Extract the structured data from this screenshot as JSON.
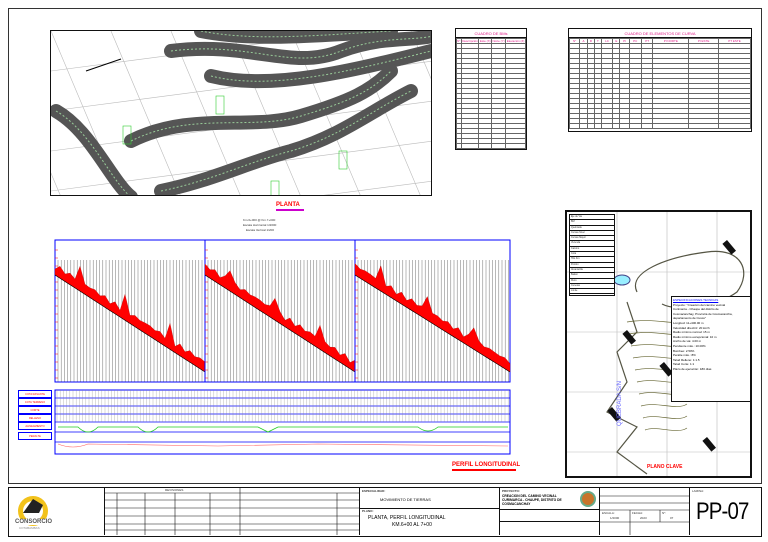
{
  "planta": {
    "label": "PLANTA",
    "scale": "1/2000"
  },
  "bm_table": {
    "title": "CUADRO DE BMs",
    "headers": [
      "N°",
      "Descripción",
      "Este (X)",
      "Norte (Y)",
      "Elevación (Z)"
    ],
    "rows": 23
  },
  "curve_table": {
    "title": "CUADRO DE ELEMENTOS DE CURVA",
    "headers": [
      "N°",
      "Δ",
      "R",
      "T",
      "LC",
      "E",
      "PI",
      "PC",
      "PT",
      "PI NORTE",
      "PI ESTE",
      "PT ESTE"
    ],
    "rows": 17
  },
  "profile": {
    "title": "PERFIL LONGITUDINAL",
    "scale": "1/2000",
    "kms": "Km.6+000 @ Km.7+000",
    "h_scale": "Escala Horizontal 1/2000",
    "v_scale": "Escala Vertical 1/200",
    "row_labels": [
      "COTA RASANTE",
      "COTA TERRENO",
      "CORTE",
      "RELLENO",
      "ALINEAMIENTO",
      "PERALTE"
    ]
  },
  "plano_clave": {
    "title": "PLANO CLAVE",
    "river": "QUEBRADA S/N",
    "spec_title": "ESPECIFICACIONES TECNICAS",
    "spec_lines": [
      "Proyecto: \"Creación del camino vecinal",
      "Curimarca - Chaupe del distrito de",
      "Cosmacanchay, Provincia de Cosmacancha,",
      "departamento de Cusco\"",
      "Longitud: 11+400.00 m",
      "Velocidad directriz: 20 km/h",
      "Radio mínimo normal: 15 m",
      "Radio mínimo excepcional: 10 m",
      "Ancho de via: 4.00 m",
      "Pendiente máx.: 10.00%",
      "Bombeo: 2.50%",
      "Peralte máx.: 8%",
      "Talud Relleno: 1:1.5",
      "Talud Corte: 1:1",
      "Plazo de ejecución: 180 días"
    ],
    "legend": [
      "Eje de Via",
      "BM",
      "Quebrada",
      "Curvas Nivel",
      "Curvas Mayor",
      "Vivienda",
      "Camino",
      "Cota",
      "Hito Km",
      "Pontón",
      "Alcantarilla",
      "Badén",
      "Muro",
      "Cunetas",
      "Limite"
    ]
  },
  "title_block": {
    "company": "CONSORCIO",
    "company_sub": "COTABAMBAS",
    "specialty_label": "ESPECIALIDAD:",
    "specialty": "MOVIMIENTO DE TIERRAS",
    "plan_label": "PLANO:",
    "plan_line1": "PLANTA, PERFIL LONGITUDINAL",
    "plan_line2": "KM.6+00 AL 7+00",
    "project_label": "PROYECTO:",
    "project": "CREACION DEL CAMINO VECINAL CURIMARCA - CHAUPE, DISTRITO DE COSMACANCHAY",
    "revisions_label": "REVISIONES",
    "sheet": "PP-07",
    "sheet_label": "LAMINA:",
    "scale_label": "ESCALA:",
    "scale": "1/2000",
    "date_label": "FECHA:",
    "date": "2023",
    "sheet_num_label": "N°:",
    "sheet_num": "07"
  },
  "colors": {
    "terrain": "#ff0000",
    "grid": "#0000ff",
    "road": "#4d4d4d",
    "accent": "#e0208a"
  }
}
